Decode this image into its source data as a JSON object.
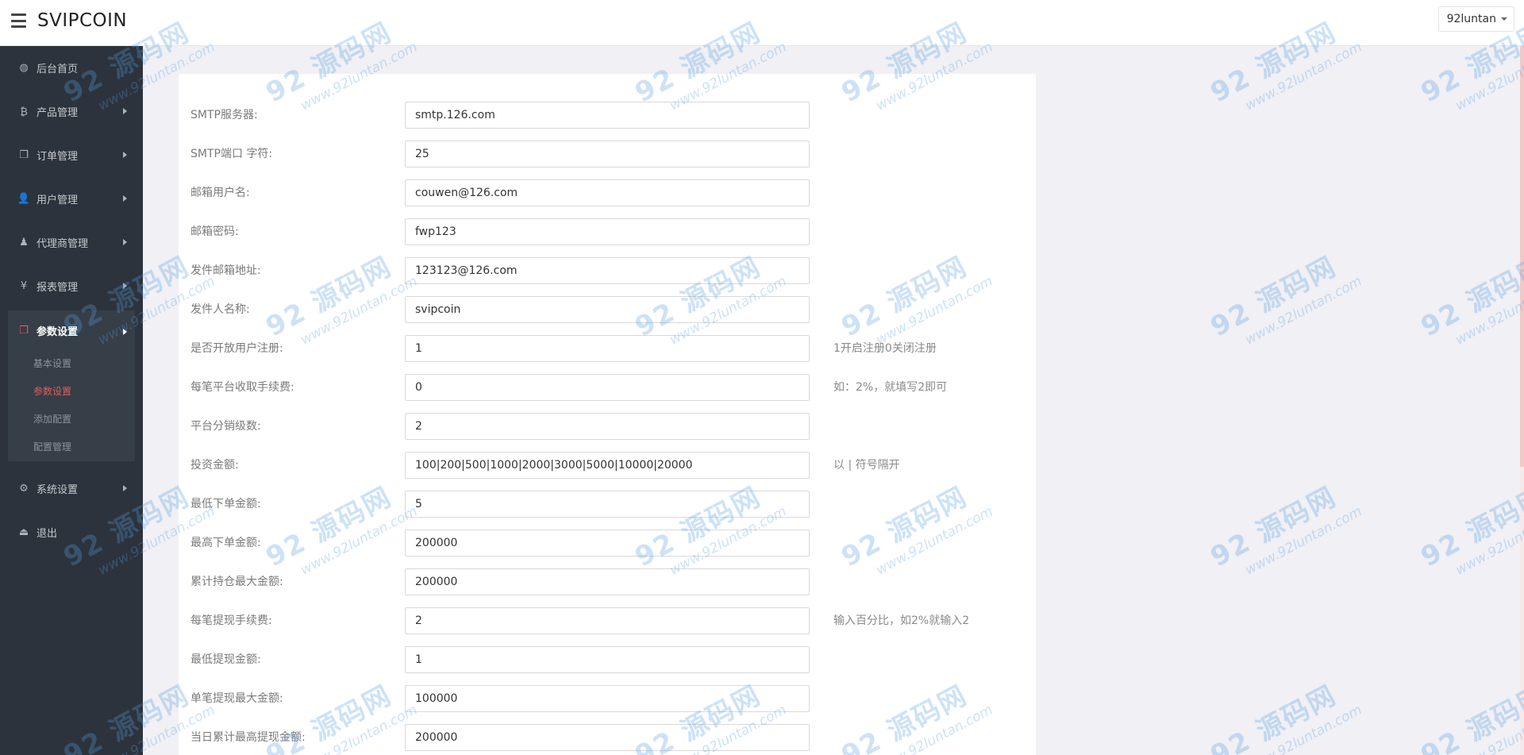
{
  "header": {
    "brand": "SVIPCOIN",
    "user": "92luntan"
  },
  "sidebar": {
    "items_top": [
      {
        "label": "后台首页",
        "icon": "dashboard-icon",
        "glyph": "◍",
        "has_arrow": false
      },
      {
        "label": "产品管理",
        "icon": "bitcoin-icon",
        "glyph": "₿",
        "has_arrow": true
      },
      {
        "label": "订单管理",
        "icon": "copy-icon",
        "glyph": "❐",
        "has_arrow": true
      },
      {
        "label": "用户管理",
        "icon": "user-icon",
        "glyph": "👤",
        "has_arrow": true
      },
      {
        "label": "代理商管理",
        "icon": "users-icon",
        "glyph": "♟",
        "has_arrow": true
      },
      {
        "label": "报表管理",
        "icon": "yen-icon",
        "glyph": "¥",
        "has_arrow": true
      }
    ],
    "active_group": {
      "label": "参数设置",
      "icon": "copy-icon",
      "glyph": "❐",
      "sub_items": [
        {
          "label": "基本设置",
          "active": false
        },
        {
          "label": "参数设置",
          "active": true
        },
        {
          "label": "添加配置",
          "active": false
        },
        {
          "label": "配置管理",
          "active": false
        }
      ]
    },
    "items_bottom": [
      {
        "label": "系统设置",
        "icon": "cogs-icon",
        "glyph": "⚙",
        "has_arrow": true
      },
      {
        "label": "退出",
        "icon": "sign-out-icon",
        "glyph": "⏏",
        "has_arrow": false
      }
    ]
  },
  "form": {
    "rows": [
      {
        "label": "SMTP服务器:",
        "value": "smtp.126.com",
        "hint": ""
      },
      {
        "label": "SMTP端口 字符:",
        "value": "25",
        "hint": ""
      },
      {
        "label": "邮箱用户名:",
        "value": "couwen@126.com",
        "hint": ""
      },
      {
        "label": "邮箱密码:",
        "value": "fwp123",
        "hint": ""
      },
      {
        "label": "发件邮箱地址:",
        "value": "123123@126.com",
        "hint": ""
      },
      {
        "label": "发件人名称:",
        "value": "svipcoin",
        "hint": ""
      },
      {
        "label": "是否开放用户注册:",
        "value": "1",
        "hint": "1开启注册0关闭注册"
      },
      {
        "label": "每笔平台收取手续费:",
        "value": "0",
        "hint": "如：2%，就填写2即可"
      },
      {
        "label": "平台分销级数:",
        "value": "2",
        "hint": ""
      },
      {
        "label": "投资金额:",
        "value": "100|200|500|1000|2000|3000|5000|10000|20000",
        "hint": "以 | 符号隔开"
      },
      {
        "label": "最低下单金额:",
        "value": "5",
        "hint": ""
      },
      {
        "label": "最高下单金额:",
        "value": "200000",
        "hint": ""
      },
      {
        "label": "累计持仓最大金额:",
        "value": "200000",
        "hint": ""
      },
      {
        "label": "每笔提现手续费:",
        "value": "2",
        "hint": "输入百分比，如2%就输入2"
      },
      {
        "label": "最低提现金额:",
        "value": "1",
        "hint": ""
      },
      {
        "label": "单笔提现最大金额:",
        "value": "100000",
        "hint": ""
      },
      {
        "label": "当日累计最高提现金额:",
        "value": "200000",
        "hint": ""
      }
    ]
  },
  "watermark": {
    "title": "92 源码网",
    "url": "www.92luntan.com"
  },
  "colors": {
    "sidebar_bg": "#2c333c",
    "accent": "#e25d5d",
    "page_bg": "#f0f0f5"
  }
}
